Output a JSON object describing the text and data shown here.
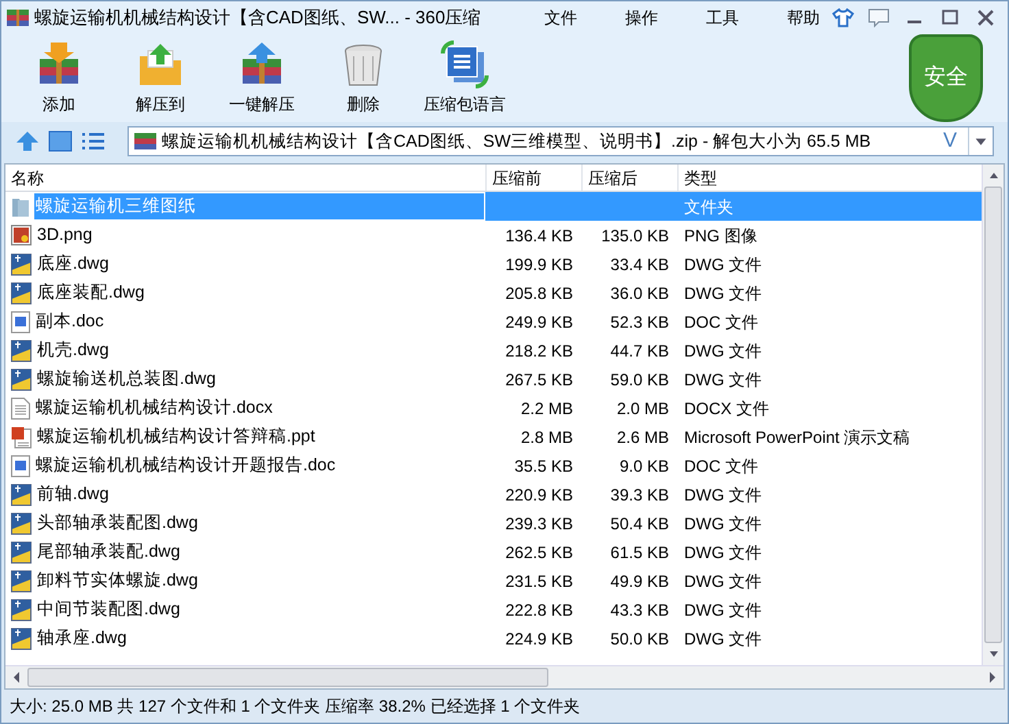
{
  "window": {
    "title": "螺旋运输机机械结构设计【含CAD图纸、SW... - 360压缩"
  },
  "menu": [
    "文件",
    "操作",
    "工具",
    "帮助"
  ],
  "toolbar": [
    {
      "kind": "add",
      "label": "添加"
    },
    {
      "kind": "extract",
      "label": "解压到"
    },
    {
      "kind": "oneclick",
      "label": "一键解压"
    },
    {
      "kind": "delete",
      "label": "删除"
    },
    {
      "kind": "language",
      "label": "压缩包语言"
    }
  ],
  "security_badge": "安全",
  "address": {
    "value": "螺旋运输机机械结构设计【含CAD图纸、SW三维模型、说明书】.zip - 解包大小为 65.5 MB",
    "hint": "V"
  },
  "table": {
    "columns": [
      "名称",
      "压缩前",
      "压缩后",
      "类型"
    ],
    "rows": [
      {
        "kind": "folder",
        "name": "螺旋运输机三维图纸",
        "size": "",
        "packed": "",
        "type": "文件夹",
        "selected": true
      },
      {
        "kind": "image",
        "name": "3D.png",
        "size": "136.4 KB",
        "packed": "135.0 KB",
        "type": "PNG 图像",
        "selected": false
      },
      {
        "kind": "dwg",
        "name": "底座.dwg",
        "size": "199.9 KB",
        "packed": "33.4 KB",
        "type": "DWG 文件",
        "selected": false
      },
      {
        "kind": "dwg",
        "name": "底座装配.dwg",
        "size": "205.8 KB",
        "packed": "36.0 KB",
        "type": "DWG 文件",
        "selected": false
      },
      {
        "kind": "doc",
        "name": "副本.doc",
        "size": "249.9 KB",
        "packed": "52.3 KB",
        "type": "DOC 文件",
        "selected": false
      },
      {
        "kind": "dwg",
        "name": "机壳.dwg",
        "size": "218.2 KB",
        "packed": "44.7 KB",
        "type": "DWG 文件",
        "selected": false
      },
      {
        "kind": "dwg",
        "name": "螺旋输送机总装图.dwg",
        "size": "267.5 KB",
        "packed": "59.0 KB",
        "type": "DWG 文件",
        "selected": false
      },
      {
        "kind": "docx",
        "name": "螺旋运输机机械结构设计.docx",
        "size": "2.2 MB",
        "packed": "2.0 MB",
        "type": "DOCX 文件",
        "selected": false
      },
      {
        "kind": "ppt",
        "name": "螺旋运输机机械结构设计答辩稿.ppt",
        "size": "2.8 MB",
        "packed": "2.6 MB",
        "type": "Microsoft PowerPoint 演示文稿",
        "selected": false
      },
      {
        "kind": "doc",
        "name": "螺旋运输机机械结构设计开题报告.doc",
        "size": "35.5 KB",
        "packed": "9.0 KB",
        "type": "DOC 文件",
        "selected": false
      },
      {
        "kind": "dwg",
        "name": "前轴.dwg",
        "size": "220.9 KB",
        "packed": "39.3 KB",
        "type": "DWG 文件",
        "selected": false
      },
      {
        "kind": "dwg",
        "name": "头部轴承装配图.dwg",
        "size": "239.3 KB",
        "packed": "50.4 KB",
        "type": "DWG 文件",
        "selected": false
      },
      {
        "kind": "dwg",
        "name": "尾部轴承装配.dwg",
        "size": "262.5 KB",
        "packed": "61.5 KB",
        "type": "DWG 文件",
        "selected": false
      },
      {
        "kind": "dwg",
        "name": "卸料节实体螺旋.dwg",
        "size": "231.5 KB",
        "packed": "49.9 KB",
        "type": "DWG 文件",
        "selected": false
      },
      {
        "kind": "dwg",
        "name": "中间节装配图.dwg",
        "size": "222.8 KB",
        "packed": "43.3 KB",
        "type": "DWG 文件",
        "selected": false
      },
      {
        "kind": "dwg",
        "name": "轴承座.dwg",
        "size": "224.9 KB",
        "packed": "50.0 KB",
        "type": "DWG 文件",
        "selected": false
      }
    ]
  },
  "status_bar": "大小: 25.0 MB 共 127 个文件和 1 个文件夹 压缩率 38.2% 已经选择 1 个文件夹"
}
